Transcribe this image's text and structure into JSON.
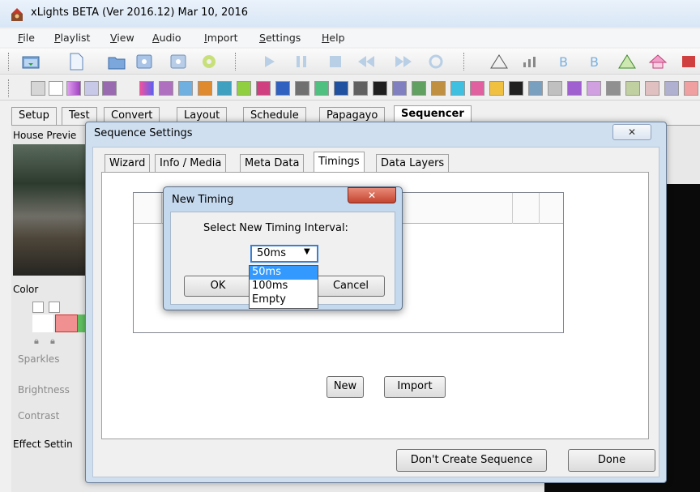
{
  "window": {
    "title": "xLights BETA (Ver 2016.12) Mar 10, 2016"
  },
  "menu": [
    "File",
    "Playlist",
    "View",
    "Audio",
    "Import",
    "Settings",
    "Help"
  ],
  "main_tabs": [
    "Setup",
    "Test",
    "Convert",
    "Layout",
    "Schedule",
    "Papagayo",
    "Sequencer"
  ],
  "side": {
    "house_preview": "House Previe",
    "color": "Color",
    "sparkles": "Sparkles",
    "brightness": "Brightness",
    "contrast": "Contrast",
    "effect_settings": "Effect Settin"
  },
  "sequence_settings": {
    "title": "Sequence Settings",
    "close_glyph": "✕",
    "tabs": [
      "Wizard",
      "Info / Media",
      "Meta Data",
      "Timings",
      "Data Layers"
    ],
    "active_tab": "Timings",
    "buttons": {
      "new": "New",
      "import": "Import",
      "dont_create": "Don't Create Sequence",
      "done": "Done"
    }
  },
  "new_timing": {
    "title": "New Timing",
    "close_glyph": "✕",
    "prompt": "Select New Timing Interval:",
    "selected": "50ms",
    "options": [
      "50ms",
      "100ms",
      "Empty"
    ],
    "ok": "OK",
    "cancel": "Cancel"
  },
  "colors": {
    "accent": "#3399ff",
    "dialog_frame": "#cfdff0",
    "close_red": "#c4452f"
  }
}
